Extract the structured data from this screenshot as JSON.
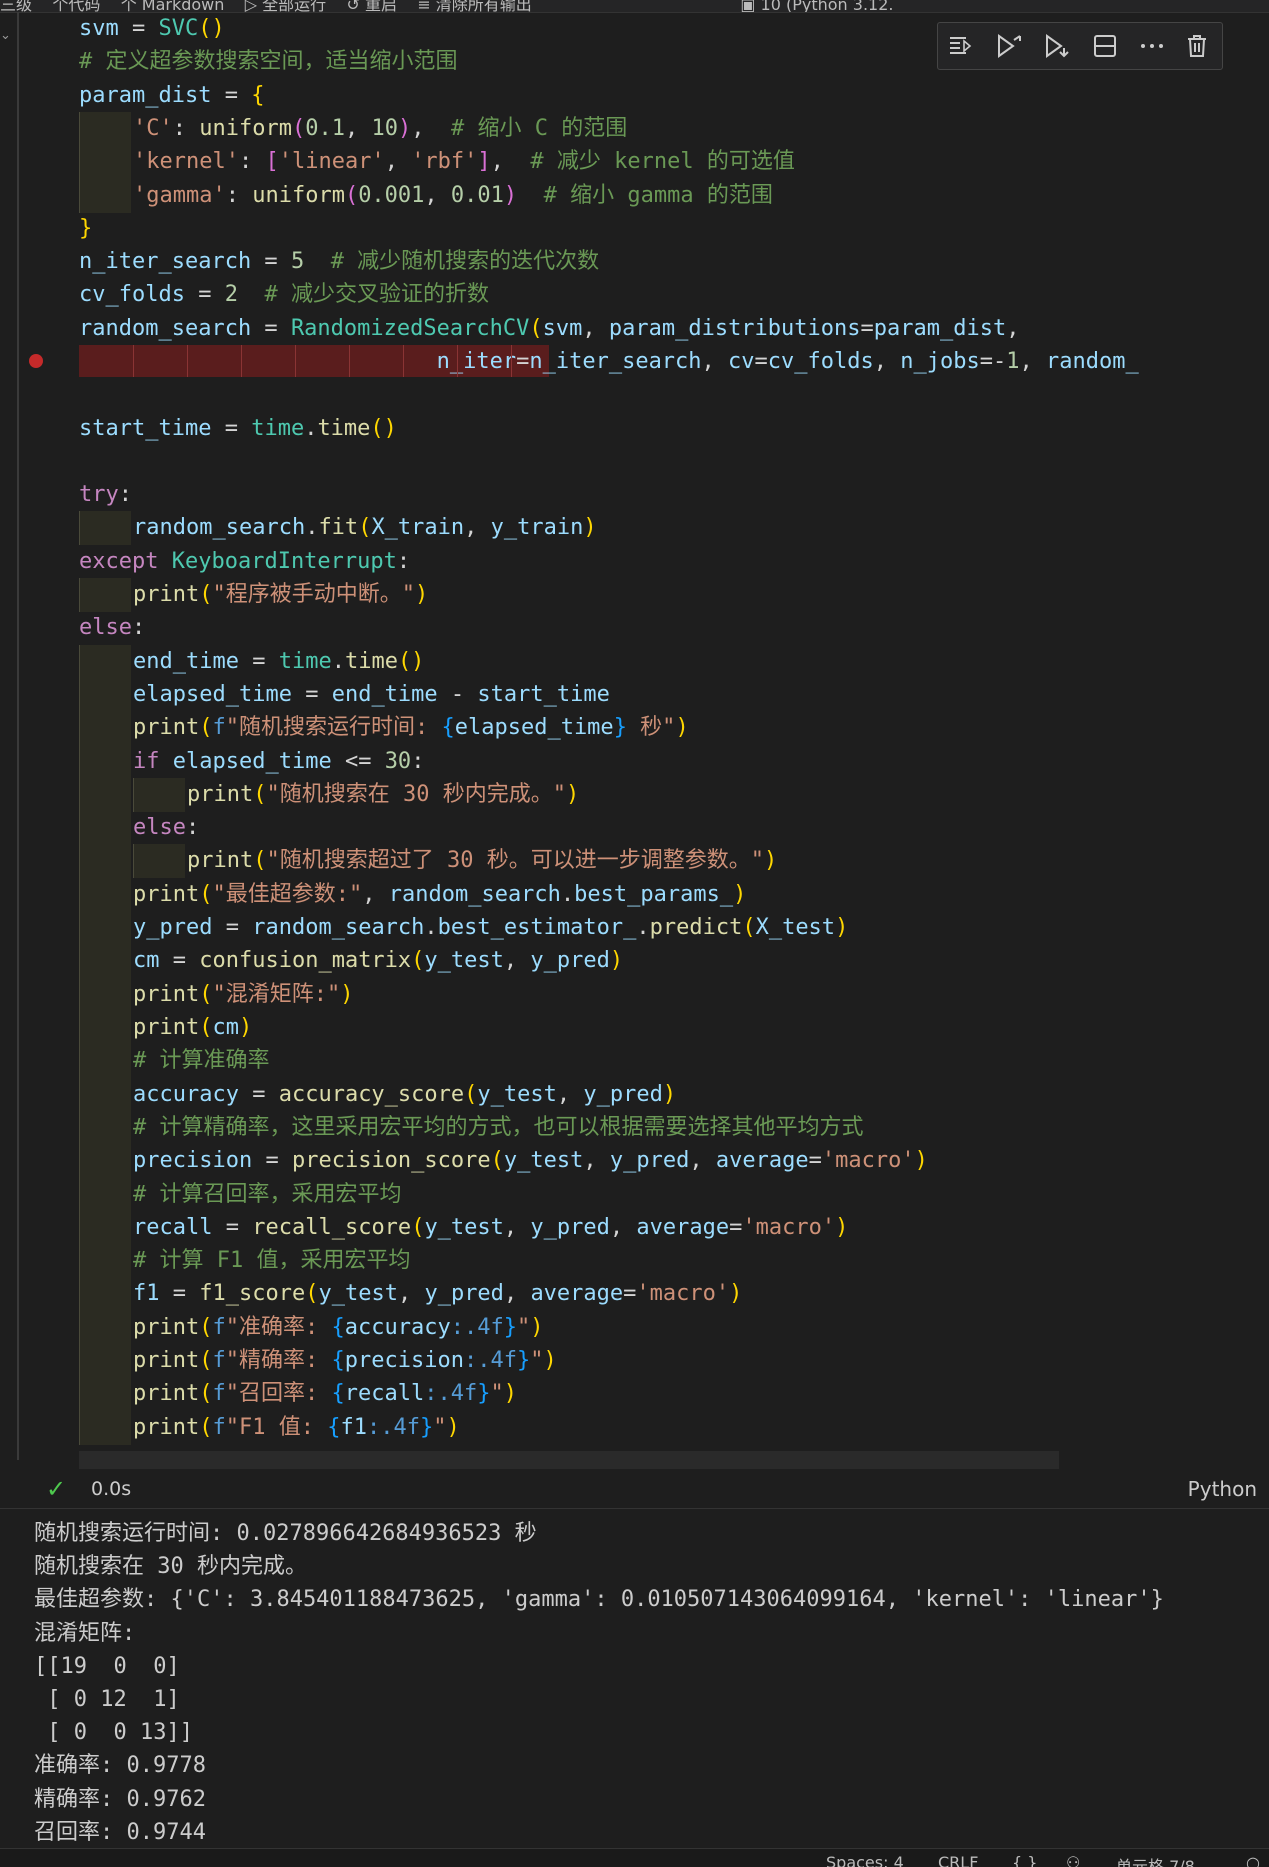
{
  "window": {
    "breadcrumb_partial": "三级    个代码    个 Markdown    ▷ 全部运行    ↺ 重启    ≡ 清除所有输出                                         ▣ 10 (Python 3.12."
  },
  "cell_toolbar": {
    "icons": [
      "run-by-line-icon",
      "execute-above-icon",
      "execute-below-icon",
      "split-cell-icon",
      "more-actions-icon",
      "delete-cell-icon"
    ]
  },
  "code_lines": [
    {
      "indent": 0,
      "parts": [
        [
          "v",
          "svm"
        ],
        [
          "op",
          " = "
        ],
        [
          "cl",
          "SVC"
        ],
        [
          "b1",
          "()"
        ]
      ]
    },
    {
      "indent": 0,
      "parts": [
        [
          "c",
          "# 定义超参数搜索空间，适当缩小范围"
        ]
      ]
    },
    {
      "indent": 0,
      "parts": [
        [
          "v",
          "param_dist"
        ],
        [
          "op",
          " = "
        ],
        [
          "b1",
          "{"
        ]
      ]
    },
    {
      "indent": 1,
      "parts": [
        [
          "s",
          "'C'"
        ],
        [
          "op",
          ": "
        ],
        [
          "f",
          "uniform"
        ],
        [
          "b2",
          "("
        ],
        [
          "n",
          "0.1"
        ],
        [
          "op",
          ", "
        ],
        [
          "n",
          "10"
        ],
        [
          "b2",
          ")"
        ],
        [
          "op",
          ",  "
        ],
        [
          "c",
          "# 缩小 C 的范围"
        ]
      ]
    },
    {
      "indent": 1,
      "parts": [
        [
          "s",
          "'kernel'"
        ],
        [
          "op",
          ": "
        ],
        [
          "b2",
          "["
        ],
        [
          "s",
          "'linear'"
        ],
        [
          "op",
          ", "
        ],
        [
          "s",
          "'rbf'"
        ],
        [
          "b2",
          "]"
        ],
        [
          "op",
          ",  "
        ],
        [
          "c",
          "# 减少 kernel 的可选值"
        ]
      ]
    },
    {
      "indent": 1,
      "parts": [
        [
          "s",
          "'gamma'"
        ],
        [
          "op",
          ": "
        ],
        [
          "f",
          "uniform"
        ],
        [
          "b2",
          "("
        ],
        [
          "n",
          "0.001"
        ],
        [
          "op",
          ", "
        ],
        [
          "n",
          "0.01"
        ],
        [
          "b2",
          ")"
        ],
        [
          "op",
          "  "
        ],
        [
          "c",
          "# 缩小 gamma 的范围"
        ]
      ]
    },
    {
      "indent": 0,
      "parts": [
        [
          "b1",
          "}"
        ]
      ]
    },
    {
      "indent": 0,
      "parts": [
        [
          "v",
          "n_iter_search"
        ],
        [
          "op",
          " = "
        ],
        [
          "n",
          "5"
        ],
        [
          "op",
          "  "
        ],
        [
          "c",
          "# 减少随机搜索的迭代次数"
        ]
      ]
    },
    {
      "indent": 0,
      "parts": [
        [
          "v",
          "cv_folds"
        ],
        [
          "op",
          " = "
        ],
        [
          "n",
          "2"
        ],
        [
          "op",
          "  "
        ],
        [
          "c",
          "# 减少交叉验证的折数"
        ]
      ]
    },
    {
      "indent": 0,
      "parts": [
        [
          "v",
          "random_search"
        ],
        [
          "op",
          " = "
        ],
        [
          "cl",
          "RandomizedSearchCV"
        ],
        [
          "b1",
          "("
        ],
        [
          "v",
          "svm"
        ],
        [
          "op",
          ", "
        ],
        [
          "v",
          "param_distributions"
        ],
        [
          "op",
          "="
        ],
        [
          "v",
          "param_dist"
        ],
        [
          "op",
          ","
        ]
      ]
    },
    {
      "indent": 0,
      "pad": "                           ",
      "parts": [
        [
          "v",
          "n_iter"
        ],
        [
          "op",
          "="
        ],
        [
          "v",
          "n_iter_search"
        ],
        [
          "op",
          ", "
        ],
        [
          "v",
          "cv"
        ],
        [
          "op",
          "="
        ],
        [
          "v",
          "cv_folds"
        ],
        [
          "op",
          ", "
        ],
        [
          "v",
          "n_jobs"
        ],
        [
          "op",
          "=-"
        ],
        [
          "n",
          "1"
        ],
        [
          "op",
          ", "
        ],
        [
          "v",
          "random_"
        ]
      ]
    },
    {
      "indent": 0,
      "parts": []
    },
    {
      "indent": 0,
      "parts": [
        [
          "v",
          "start_time"
        ],
        [
          "op",
          " = "
        ],
        [
          "cl",
          "time"
        ],
        [
          "op",
          "."
        ],
        [
          "f",
          "time"
        ],
        [
          "b1",
          "()"
        ]
      ]
    },
    {
      "indent": 0,
      "parts": []
    },
    {
      "indent": 0,
      "parts": [
        [
          "k",
          "try"
        ],
        [
          "op",
          ":"
        ]
      ]
    },
    {
      "indent": 1,
      "parts": [
        [
          "v",
          "random_search"
        ],
        [
          "op",
          "."
        ],
        [
          "f",
          "fit"
        ],
        [
          "b1",
          "("
        ],
        [
          "v",
          "X_train"
        ],
        [
          "op",
          ", "
        ],
        [
          "v",
          "y_train"
        ],
        [
          "b1",
          ")"
        ]
      ]
    },
    {
      "indent": 0,
      "parts": [
        [
          "k",
          "except"
        ],
        [
          "op",
          " "
        ],
        [
          "cl",
          "KeyboardInterrupt"
        ],
        [
          "op",
          ":"
        ]
      ]
    },
    {
      "indent": 1,
      "parts": [
        [
          "f",
          "print"
        ],
        [
          "b1",
          "("
        ],
        [
          "s",
          "\"程序被手动中断。\""
        ],
        [
          "b1",
          ")"
        ]
      ]
    },
    {
      "indent": 0,
      "parts": [
        [
          "k",
          "else"
        ],
        [
          "op",
          ":"
        ]
      ]
    },
    {
      "indent": 1,
      "parts": [
        [
          "v",
          "end_time"
        ],
        [
          "op",
          " = "
        ],
        [
          "cl",
          "time"
        ],
        [
          "op",
          "."
        ],
        [
          "f",
          "time"
        ],
        [
          "b1",
          "()"
        ]
      ]
    },
    {
      "indent": 1,
      "parts": [
        [
          "v",
          "elapsed_time"
        ],
        [
          "op",
          " = "
        ],
        [
          "v",
          "end_time"
        ],
        [
          "op",
          " - "
        ],
        [
          "v",
          "start_time"
        ]
      ]
    },
    {
      "indent": 1,
      "parts": [
        [
          "f",
          "print"
        ],
        [
          "b1",
          "("
        ],
        [
          "bk",
          "f"
        ],
        [
          "s",
          "\"随机搜索运行时间: "
        ],
        [
          "b3",
          "{"
        ],
        [
          "v",
          "elapsed_time"
        ],
        [
          "b3",
          "}"
        ],
        [
          "s",
          " 秒\""
        ],
        [
          "b1",
          ")"
        ]
      ]
    },
    {
      "indent": 1,
      "parts": [
        [
          "k",
          "if"
        ],
        [
          "op",
          " "
        ],
        [
          "v",
          "elapsed_time"
        ],
        [
          "op",
          " <= "
        ],
        [
          "n",
          "30"
        ],
        [
          "op",
          ":"
        ]
      ]
    },
    {
      "indent": 2,
      "parts": [
        [
          "f",
          "print"
        ],
        [
          "b1",
          "("
        ],
        [
          "s",
          "\"随机搜索在 30 秒内完成。\""
        ],
        [
          "b1",
          ")"
        ]
      ]
    },
    {
      "indent": 1,
      "parts": [
        [
          "k",
          "else"
        ],
        [
          "op",
          ":"
        ]
      ]
    },
    {
      "indent": 2,
      "parts": [
        [
          "f",
          "print"
        ],
        [
          "b1",
          "("
        ],
        [
          "s",
          "\"随机搜索超过了 30 秒。可以进一步调整参数。\""
        ],
        [
          "b1",
          ")"
        ]
      ]
    },
    {
      "indent": 1,
      "parts": [
        [
          "f",
          "print"
        ],
        [
          "b1",
          "("
        ],
        [
          "s",
          "\"最佳超参数:\""
        ],
        [
          "op",
          ", "
        ],
        [
          "v",
          "random_search"
        ],
        [
          "op",
          "."
        ],
        [
          "v",
          "best_params_"
        ],
        [
          "b1",
          ")"
        ]
      ]
    },
    {
      "indent": 1,
      "parts": [
        [
          "v",
          "y_pred"
        ],
        [
          "op",
          " = "
        ],
        [
          "v",
          "random_search"
        ],
        [
          "op",
          "."
        ],
        [
          "v",
          "best_estimator_"
        ],
        [
          "op",
          "."
        ],
        [
          "f",
          "predict"
        ],
        [
          "b1",
          "("
        ],
        [
          "v",
          "X_test"
        ],
        [
          "b1",
          ")"
        ]
      ]
    },
    {
      "indent": 1,
      "parts": [
        [
          "v",
          "cm"
        ],
        [
          "op",
          " = "
        ],
        [
          "f",
          "confusion_matrix"
        ],
        [
          "b1",
          "("
        ],
        [
          "v",
          "y_test"
        ],
        [
          "op",
          ", "
        ],
        [
          "v",
          "y_pred"
        ],
        [
          "b1",
          ")"
        ]
      ]
    },
    {
      "indent": 1,
      "parts": [
        [
          "f",
          "print"
        ],
        [
          "b1",
          "("
        ],
        [
          "s",
          "\"混淆矩阵:\""
        ],
        [
          "b1",
          ")"
        ]
      ]
    },
    {
      "indent": 1,
      "parts": [
        [
          "f",
          "print"
        ],
        [
          "b1",
          "("
        ],
        [
          "v",
          "cm"
        ],
        [
          "b1",
          ")"
        ]
      ]
    },
    {
      "indent": 1,
      "parts": [
        [
          "c",
          "# 计算准确率"
        ]
      ]
    },
    {
      "indent": 1,
      "parts": [
        [
          "v",
          "accuracy"
        ],
        [
          "op",
          " = "
        ],
        [
          "f",
          "accuracy_score"
        ],
        [
          "b1",
          "("
        ],
        [
          "v",
          "y_test"
        ],
        [
          "op",
          ", "
        ],
        [
          "v",
          "y_pred"
        ],
        [
          "b1",
          ")"
        ]
      ]
    },
    {
      "indent": 1,
      "parts": [
        [
          "c",
          "# 计算精确率，这里采用宏平均的方式，也可以根据需要选择其他平均方式"
        ]
      ]
    },
    {
      "indent": 1,
      "parts": [
        [
          "v",
          "precision"
        ],
        [
          "op",
          " = "
        ],
        [
          "f",
          "precision_score"
        ],
        [
          "b1",
          "("
        ],
        [
          "v",
          "y_test"
        ],
        [
          "op",
          ", "
        ],
        [
          "v",
          "y_pred"
        ],
        [
          "op",
          ", "
        ],
        [
          "v",
          "average"
        ],
        [
          "op",
          "="
        ],
        [
          "s",
          "'macro'"
        ],
        [
          "b1",
          ")"
        ]
      ]
    },
    {
      "indent": 1,
      "parts": [
        [
          "c",
          "# 计算召回率，采用宏平均"
        ]
      ]
    },
    {
      "indent": 1,
      "parts": [
        [
          "v",
          "recall"
        ],
        [
          "op",
          " = "
        ],
        [
          "f",
          "recall_score"
        ],
        [
          "b1",
          "("
        ],
        [
          "v",
          "y_test"
        ],
        [
          "op",
          ", "
        ],
        [
          "v",
          "y_pred"
        ],
        [
          "op",
          ", "
        ],
        [
          "v",
          "average"
        ],
        [
          "op",
          "="
        ],
        [
          "s",
          "'macro'"
        ],
        [
          "b1",
          ")"
        ]
      ]
    },
    {
      "indent": 1,
      "parts": [
        [
          "c",
          "# 计算 F1 值，采用宏平均"
        ]
      ]
    },
    {
      "indent": 1,
      "parts": [
        [
          "v",
          "f1"
        ],
        [
          "op",
          " = "
        ],
        [
          "f",
          "f1_score"
        ],
        [
          "b1",
          "("
        ],
        [
          "v",
          "y_test"
        ],
        [
          "op",
          ", "
        ],
        [
          "v",
          "y_pred"
        ],
        [
          "op",
          ", "
        ],
        [
          "v",
          "average"
        ],
        [
          "op",
          "="
        ],
        [
          "s",
          "'macro'"
        ],
        [
          "b1",
          ")"
        ]
      ]
    },
    {
      "indent": 1,
      "parts": [
        [
          "f",
          "print"
        ],
        [
          "b1",
          "("
        ],
        [
          "bk",
          "f"
        ],
        [
          "s",
          "\"准确率: "
        ],
        [
          "b3",
          "{"
        ],
        [
          "v",
          "accuracy"
        ],
        [
          "bk",
          ":.4f"
        ],
        [
          "b3",
          "}"
        ],
        [
          "s",
          "\""
        ],
        [
          "b1",
          ")"
        ]
      ]
    },
    {
      "indent": 1,
      "parts": [
        [
          "f",
          "print"
        ],
        [
          "b1",
          "("
        ],
        [
          "bk",
          "f"
        ],
        [
          "s",
          "\"精确率: "
        ],
        [
          "b3",
          "{"
        ],
        [
          "v",
          "precision"
        ],
        [
          "bk",
          ":.4f"
        ],
        [
          "b3",
          "}"
        ],
        [
          "s",
          "\""
        ],
        [
          "b1",
          ")"
        ]
      ]
    },
    {
      "indent": 1,
      "parts": [
        [
          "f",
          "print"
        ],
        [
          "b1",
          "("
        ],
        [
          "bk",
          "f"
        ],
        [
          "s",
          "\"召回率: "
        ],
        [
          "b3",
          "{"
        ],
        [
          "v",
          "recall"
        ],
        [
          "bk",
          ":.4f"
        ],
        [
          "b3",
          "}"
        ],
        [
          "s",
          "\""
        ],
        [
          "b1",
          ")"
        ]
      ]
    },
    {
      "indent": 1,
      "parts": [
        [
          "f",
          "print"
        ],
        [
          "b1",
          "("
        ],
        [
          "bk",
          "f"
        ],
        [
          "s",
          "\"F1 值: "
        ],
        [
          "b3",
          "{"
        ],
        [
          "v",
          "f1"
        ],
        [
          "bk",
          ":.4f"
        ],
        [
          "b3",
          "}"
        ],
        [
          "s",
          "\""
        ],
        [
          "b1",
          ")"
        ]
      ]
    }
  ],
  "cell_status": {
    "check": "✓",
    "duration": "0.0s",
    "language": "Python"
  },
  "output_lines": [
    "随机搜索运行时间: 0.027896642684936523 秒",
    "随机搜索在 30 秒内完成。",
    "最佳超参数: {'C': 3.845401188473625, 'gamma': 0.010507143064099164, 'kernel': 'linear'}",
    "混淆矩阵:",
    "[[19  0  0]",
    " [ 0 12  1]",
    " [ 0  0 13]]",
    "准确率: 0.9778",
    "精确率: 0.9762",
    "召回率: 0.9744"
  ],
  "status_bar": {
    "spaces": "Spaces: 4",
    "eol": "CRLF",
    "braces": "{ }",
    "cell_position": "单元格 7/8"
  },
  "colors": {
    "background": "#1e1e1e",
    "keyword": "#c586c0",
    "function": "#dcdcaa",
    "string": "#ce9178",
    "variable": "#9cdcfe",
    "number": "#b5cea8",
    "comment": "#6a9955",
    "class": "#4ec9b0",
    "success": "#4ec94e",
    "breakpoint": "#c52a2a"
  }
}
